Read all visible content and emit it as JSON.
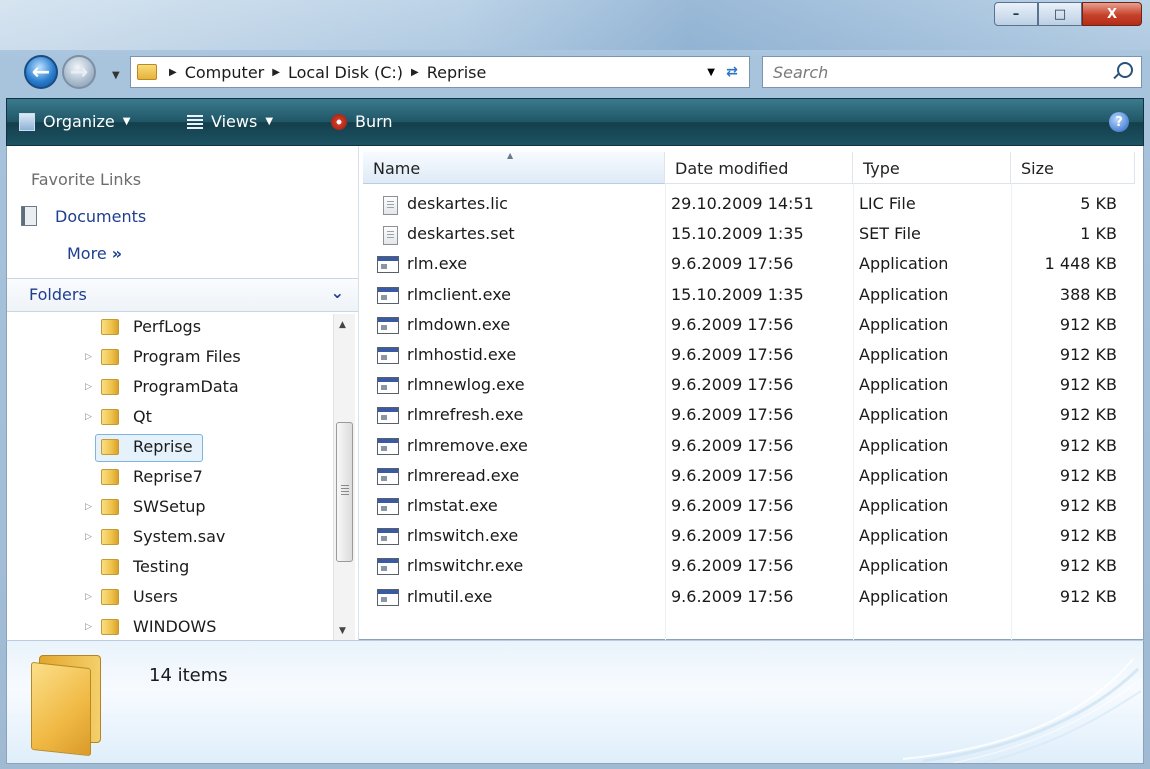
{
  "window": {
    "controls": {
      "minimize": "–",
      "maximize": "□",
      "close": "X"
    }
  },
  "address": {
    "crumbs": [
      "Computer",
      "Local Disk (C:)",
      "Reprise"
    ],
    "search_placeholder": "Search"
  },
  "toolbar": {
    "organize": "Organize",
    "views": "Views",
    "burn": "Burn",
    "help": "?"
  },
  "nav": {
    "favorite_links_title": "Favorite Links",
    "documents": "Documents",
    "more": "More",
    "more_glyph": "»",
    "folders_title": "Folders",
    "folders_chevron": "⌄",
    "tree": [
      {
        "label": "PerfLogs",
        "expandable": false,
        "selected": false
      },
      {
        "label": "Program Files",
        "expandable": true,
        "selected": false
      },
      {
        "label": "ProgramData",
        "expandable": true,
        "selected": false
      },
      {
        "label": "Qt",
        "expandable": true,
        "selected": false
      },
      {
        "label": "Reprise",
        "expandable": false,
        "selected": true
      },
      {
        "label": "Reprise7",
        "expandable": false,
        "selected": false
      },
      {
        "label": "SWSetup",
        "expandable": true,
        "selected": false
      },
      {
        "label": "System.sav",
        "expandable": true,
        "selected": false
      },
      {
        "label": "Testing",
        "expandable": false,
        "selected": false
      },
      {
        "label": "Users",
        "expandable": true,
        "selected": false
      },
      {
        "label": "WINDOWS",
        "expandable": true,
        "selected": false
      }
    ]
  },
  "columns": {
    "name": "Name",
    "date": "Date modified",
    "type": "Type",
    "size": "Size"
  },
  "files": [
    {
      "name": "deskartes.lic",
      "date": "29.10.2009 14:51",
      "type": "LIC File",
      "size": "5 KB",
      "icon": "document-icon"
    },
    {
      "name": "deskartes.set",
      "date": "15.10.2009 1:35",
      "type": "SET File",
      "size": "1 KB",
      "icon": "document-icon"
    },
    {
      "name": "rlm.exe",
      "date": "9.6.2009 17:56",
      "type": "Application",
      "size": "1 448 KB",
      "icon": "application-icon"
    },
    {
      "name": "rlmclient.exe",
      "date": "15.10.2009 1:35",
      "type": "Application",
      "size": "388 KB",
      "icon": "application-icon"
    },
    {
      "name": "rlmdown.exe",
      "date": "9.6.2009 17:56",
      "type": "Application",
      "size": "912 KB",
      "icon": "application-icon"
    },
    {
      "name": "rlmhostid.exe",
      "date": "9.6.2009 17:56",
      "type": "Application",
      "size": "912 KB",
      "icon": "application-icon"
    },
    {
      "name": "rlmnewlog.exe",
      "date": "9.6.2009 17:56",
      "type": "Application",
      "size": "912 KB",
      "icon": "application-icon"
    },
    {
      "name": "rlmrefresh.exe",
      "date": "9.6.2009 17:56",
      "type": "Application",
      "size": "912 KB",
      "icon": "application-icon"
    },
    {
      "name": "rlmremove.exe",
      "date": "9.6.2009 17:56",
      "type": "Application",
      "size": "912 KB",
      "icon": "application-icon"
    },
    {
      "name": "rlmreread.exe",
      "date": "9.6.2009 17:56",
      "type": "Application",
      "size": "912 KB",
      "icon": "application-icon"
    },
    {
      "name": "rlmstat.exe",
      "date": "9.6.2009 17:56",
      "type": "Application",
      "size": "912 KB",
      "icon": "application-icon"
    },
    {
      "name": "rlmswitch.exe",
      "date": "9.6.2009 17:56",
      "type": "Application",
      "size": "912 KB",
      "icon": "application-icon"
    },
    {
      "name": "rlmswitchr.exe",
      "date": "9.6.2009 17:56",
      "type": "Application",
      "size": "912 KB",
      "icon": "application-icon"
    },
    {
      "name": "rlmutil.exe",
      "date": "9.6.2009 17:56",
      "type": "Application",
      "size": "912 KB",
      "icon": "application-icon"
    }
  ],
  "status": {
    "items_count": "14 items"
  },
  "colors": {
    "toolbar": "#1f5666",
    "link": "#1e3e8e",
    "selection": "#e5f1fb"
  }
}
